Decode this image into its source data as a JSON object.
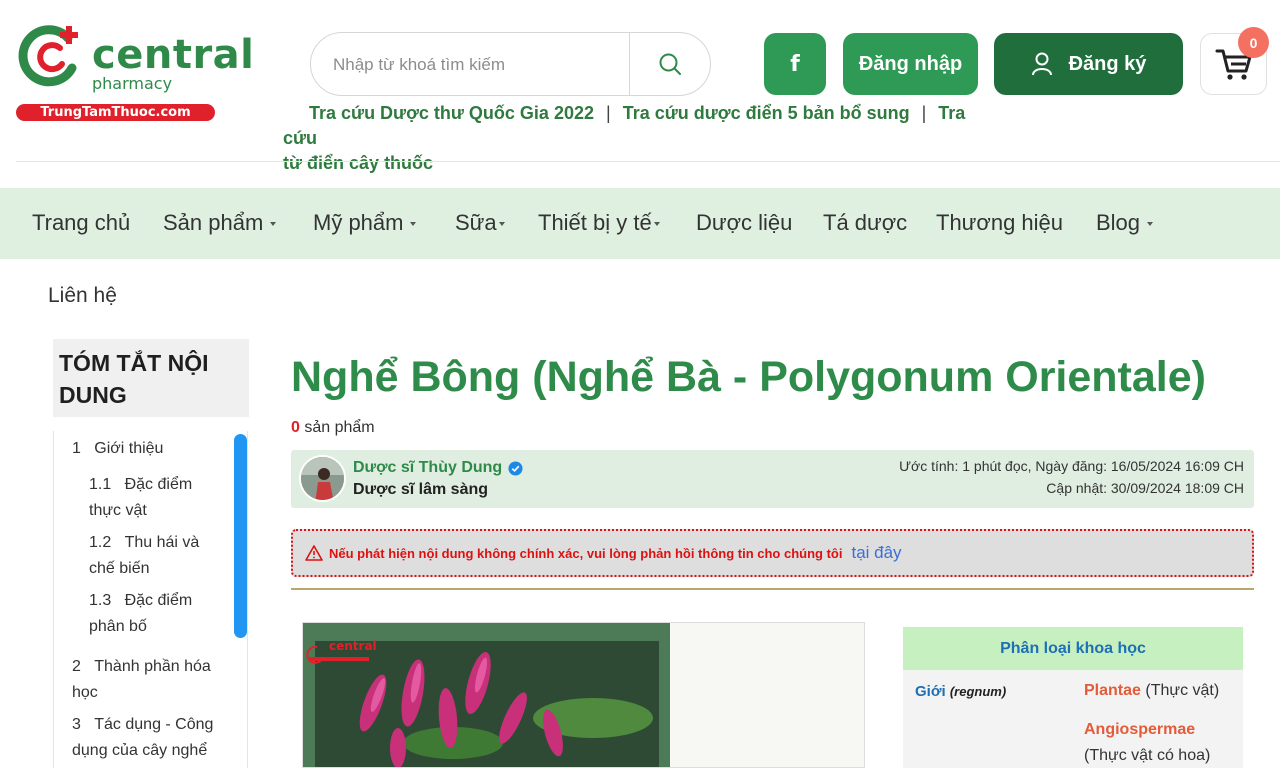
{
  "logo": {
    "word": "central",
    "sub": "pharmacy",
    "bar": "TrungTamThuoc.com"
  },
  "search": {
    "placeholder": "Nhập từ khoá tìm kiếm"
  },
  "header": {
    "fb_label": "f",
    "login_label": "Đăng nhập",
    "register_label": "Đăng ký",
    "cart_count": "0"
  },
  "quick_links": {
    "link1": "Tra cứu Dược thư Quốc Gia 2022",
    "link2": "Tra cứu dược điển 5 bản bổ sung",
    "link3a": "Tra cứu",
    "link3b": "từ điển cây thuốc",
    "sep": "|"
  },
  "nav": {
    "items": [
      "Trang chủ",
      "Sản phẩm",
      "Mỹ phẩm",
      "Sữa",
      "Thiết bị y tế",
      "Dược liệu",
      "Tá dược",
      "Thương hiệu",
      "Blog"
    ]
  },
  "contact": "Liên hệ",
  "toc": {
    "title": "TÓM TẮT NỘI DUNG",
    "items": [
      {
        "num": "1",
        "line1": "Giới thiệu",
        "line2": ""
      },
      {
        "num": "1.1",
        "line1": "Đặc điểm",
        "line2": "thực vật"
      },
      {
        "num": "1.2",
        "line1": "Thu hái và",
        "line2": "chế biến"
      },
      {
        "num": "1.3",
        "line1": "Đặc điểm",
        "line2": "phân bố"
      },
      {
        "num": "2",
        "line1": "Thành phần hóa",
        "line2": "học"
      },
      {
        "num": "3",
        "line1": "Tác dụng - Công",
        "line2": "dụng của cây nghể"
      }
    ]
  },
  "article": {
    "title": "Nghể Bông (Nghể Bà - Polygonum Orientale)",
    "product_count": "0",
    "product_label": "sản phẩm",
    "author_name": "Dược sĩ Thùy Dung",
    "author_role": "Dược sĩ lâm sàng",
    "meta_line1": "Ước tính: 1 phút đọc, Ngày đăng: 16/05/2024 16:09 CH",
    "meta_line2": "Cập nhật: 30/09/2024 18:09 CH",
    "warning_text": "Nếu phát hiện nội dung không chính xác, vui lòng phản hồi thông tin cho chúng tôi",
    "warning_link": "tại đây",
    "figure_watermark": "central"
  },
  "classification": {
    "header": "Phân loại khoa học",
    "rank_label": "Giới",
    "rank_latin": "(regnum)",
    "val1_latin": "Plantae",
    "val1_vn": "(Thực vật)",
    "val2_latin": "Angiospermae",
    "val2_vn": "(Thực vật có hoa)"
  },
  "colors": {
    "brand_green": "#2e8b4a",
    "dark_green": "#1f6e3b",
    "nav_bg": "#dff0e1",
    "accent_red": "#e0202a",
    "toc_scroll": "#2196f3"
  }
}
